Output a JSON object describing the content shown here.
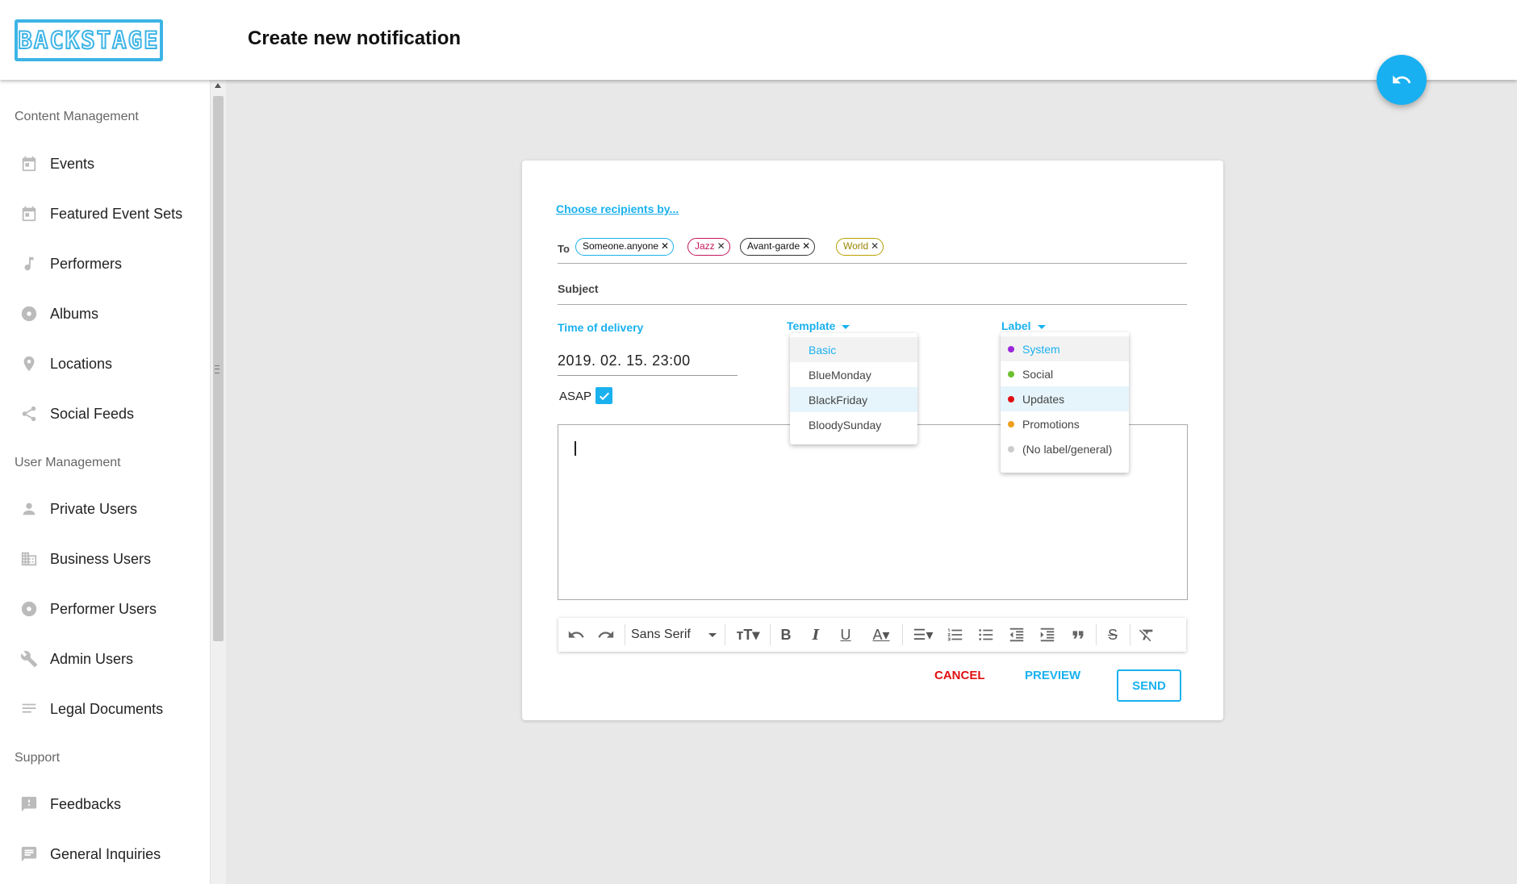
{
  "header": {
    "logo_text": "BACKSTAGE",
    "title": "Create new notification",
    "fab_icon": "undo-icon"
  },
  "sidebar": {
    "sections": [
      {
        "label": "Content Management",
        "items": [
          {
            "label": "Events",
            "icon": "calendar-icon"
          },
          {
            "label": "Featured Event Sets",
            "icon": "calendar-icon"
          },
          {
            "label": "Performers",
            "icon": "music-note-icon"
          },
          {
            "label": "Albums",
            "icon": "disc-icon"
          },
          {
            "label": "Locations",
            "icon": "location-pin-icon"
          },
          {
            "label": "Social Feeds",
            "icon": "share-icon"
          }
        ]
      },
      {
        "label": "User Management",
        "items": [
          {
            "label": "Private Users",
            "icon": "person-icon"
          },
          {
            "label": "Business Users",
            "icon": "building-icon"
          },
          {
            "label": "Performer Users",
            "icon": "disc-icon"
          },
          {
            "label": "Admin Users",
            "icon": "wrench-icon"
          },
          {
            "label": "Legal Documents",
            "icon": "lines-icon"
          }
        ]
      },
      {
        "label": "Support",
        "items": [
          {
            "label": "Feedbacks",
            "icon": "feedback-icon"
          },
          {
            "label": "General Inquiries",
            "icon": "message-icon"
          }
        ]
      }
    ]
  },
  "form": {
    "recipients_link": "Choose recipients by...",
    "to_label": "To",
    "chips": [
      {
        "label": "Someone.anyone",
        "color": "#1ab1ef"
      },
      {
        "label": "Jazz",
        "color": "#c2185b"
      },
      {
        "label": "Avant-garde",
        "color": "#333333"
      },
      {
        "label": "World",
        "color": "#b8a000"
      }
    ],
    "subject_label": "Subject",
    "time_label": "Time of delivery",
    "time_value": "2019. 02. 15. 23:00",
    "asap_label": "ASAP",
    "asap_checked": true,
    "template_label": "Template",
    "label_label": "Label"
  },
  "template_dropdown": {
    "options": [
      "Basic",
      "BlueMonday",
      "BlackFriday",
      "BloodySunday"
    ],
    "selected": "Basic",
    "hovered": "BlackFriday"
  },
  "label_dropdown": {
    "options": [
      {
        "label": "System",
        "color": "#9c27d9"
      },
      {
        "label": "Social",
        "color": "#6dc030"
      },
      {
        "label": "Updates",
        "color": "#e01010"
      },
      {
        "label": "Promotions",
        "color": "#f0a020"
      },
      {
        "label": "(No label/general)",
        "color": "#cccccc"
      }
    ],
    "selected": "System",
    "hovered": "Updates"
  },
  "toolbar": {
    "font": "Sans Serif",
    "buttons": [
      "undo-icon",
      "redo-icon",
      "font-size-icon",
      "bold-icon",
      "italic-icon",
      "underline-icon",
      "text-color-icon",
      "align-icon",
      "ordered-list-icon",
      "bullet-list-icon",
      "outdent-icon",
      "indent-icon",
      "quote-icon",
      "strikethrough-icon",
      "clear-format-icon"
    ]
  },
  "actions": {
    "cancel": "CANCEL",
    "preview": "PREVIEW",
    "send": "SEND"
  },
  "colors": {
    "accent": "#1ab1ef",
    "danger": "#e01010"
  }
}
